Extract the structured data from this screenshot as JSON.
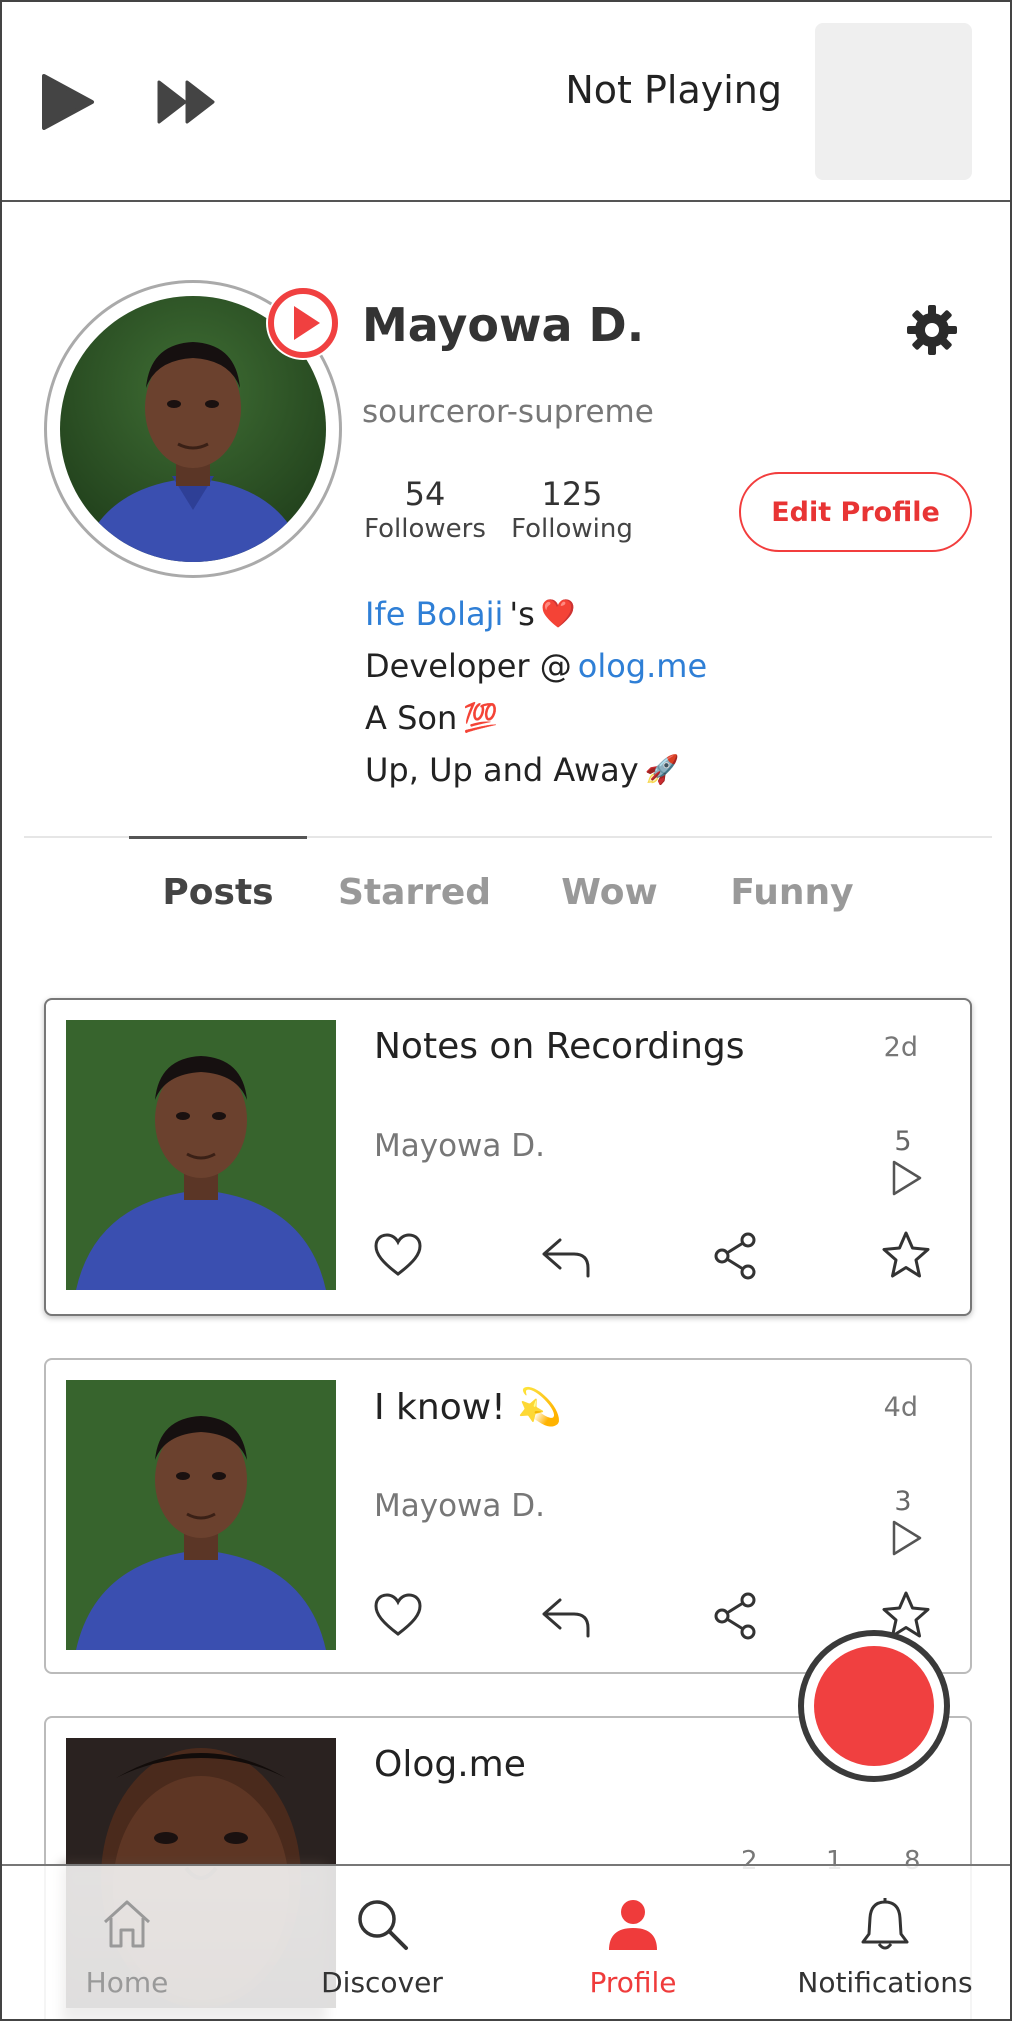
{
  "player": {
    "status": "Not Playing",
    "play_icon": "play-icon",
    "forward_icon": "fast-forward-icon"
  },
  "profile": {
    "name": "Mayowa D.",
    "handle": "sourceror-supreme",
    "followers_count": "54",
    "followers_label": "Followers",
    "following_count": "125",
    "following_label": "Following",
    "edit_button": "Edit Profile",
    "bio": {
      "line1_link": "Ife Bolaji",
      "line1_text": " 's",
      "line1_emoji": "❤️",
      "line2_text": "Developer @",
      "line2_link": "olog.me",
      "line3_text": "A Son",
      "line3_emoji": "💯",
      "line4_text": "Up, Up and Away",
      "line4_emoji": "🚀"
    }
  },
  "tabs": [
    {
      "label": "Posts",
      "active": true
    },
    {
      "label": "Starred",
      "active": false
    },
    {
      "label": "Wow",
      "active": false
    },
    {
      "label": "Funny",
      "active": false
    }
  ],
  "posts": [
    {
      "title": "Notes on Recordings",
      "time": "2d",
      "author": "Mayowa D.",
      "plays": "5"
    },
    {
      "title": "I know! 💫",
      "time": "4d",
      "author": "Mayowa D.",
      "plays": "3"
    },
    {
      "title": "Olog.me",
      "time": "",
      "author": "",
      "plays": ""
    }
  ],
  "post3_partial": {
    "counts": [
      "2",
      "1",
      "8"
    ]
  },
  "nav": [
    {
      "label": "Home",
      "icon": "home-icon"
    },
    {
      "label": "Discover",
      "icon": "search-icon"
    },
    {
      "label": "Profile",
      "icon": "person-icon"
    },
    {
      "label": "Notifications",
      "icon": "bell-icon"
    }
  ],
  "colors": {
    "accent": "#f04040",
    "link": "#2f7fd6"
  }
}
